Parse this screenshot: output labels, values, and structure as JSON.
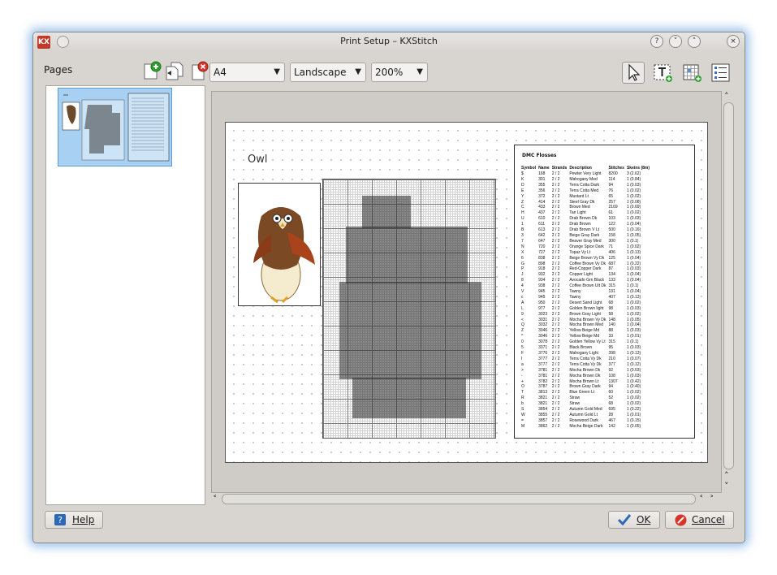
{
  "window": {
    "title": "Print Setup – KXStitch",
    "app_icon_text": "KX",
    "title_buttons": [
      "?",
      "˅",
      "˄",
      "×"
    ]
  },
  "pages_label": "Pages",
  "toolbar": {
    "paper_size": "A4",
    "orientation": "Landscape",
    "zoom": "200%",
    "icons": [
      "add-page-icon",
      "insert-page-icon",
      "delete-page-icon",
      "select-tool-icon",
      "text-tool-icon",
      "pattern-tool-icon",
      "key-tool-icon"
    ]
  },
  "preview": {
    "pattern_title": "Owl",
    "floss_title": "DMC Flosses",
    "floss_headers": [
      "Symbol",
      "Name",
      "Strands",
      "Description",
      "Stitches",
      "Skeins (8m)"
    ],
    "floss_rows": [
      [
        "$",
        "168",
        "2 / 2",
        "Pewter Very Light",
        "8200",
        "3 (2.62)"
      ],
      [
        "K",
        "301",
        "2 / 2",
        "Mahogany Med",
        "114",
        "1 (0.84)"
      ],
      [
        "D",
        "355",
        "2 / 2",
        "Terra Cotta Dark",
        "94",
        "1 (0.03)"
      ],
      [
        "E",
        "356",
        "2 / 2",
        "Terra Cotta Med",
        "76",
        "1 (0.02)"
      ],
      [
        "Y",
        "372",
        "2 / 2",
        "Mustard Lt",
        "65",
        "1 (0.02)"
      ],
      [
        "Z",
        "414",
        "2 / 2",
        "Steel Gray Dk",
        "257",
        "1 (0.08)"
      ],
      [
        "C",
        "433",
        "2 / 2",
        "Brown Med",
        "2169",
        "1 (0.69)"
      ],
      [
        "H",
        "437",
        "2 / 2",
        "Tan Light",
        "61",
        "1 (0.02)"
      ],
      [
        "U",
        "610",
        "2 / 2",
        "Drab Brown Dk",
        "103",
        "1 (0.03)"
      ],
      [
        "1",
        "611",
        "2 / 2",
        "Drab Brown",
        "122",
        "1 (0.04)"
      ],
      [
        "B",
        "613",
        "2 / 2",
        "Drab Brown V Lt",
        "500",
        "1 (0.16)"
      ],
      [
        "3",
        "642",
        "2 / 2",
        "Beige Gray Dark",
        "158",
        "1 (0.05)"
      ],
      [
        "7",
        "647",
        "2 / 2",
        "Beaver Gray Med",
        "300",
        "1 (0.1)"
      ],
      [
        "N",
        "720",
        "2 / 2",
        "Orange Spice Dark",
        "71",
        "1 (0.02)"
      ],
      [
        "X",
        "727",
        "2 / 2",
        "Topaz Vy Lt",
        "406",
        "1 (0.13)"
      ],
      [
        "6",
        "838",
        "2 / 2",
        "Beige Brown Vy Dk",
        "125",
        "1 (0.04)"
      ],
      [
        "G",
        "898",
        "2 / 2",
        "Coffee Brown Vy Dk",
        "687",
        "1 (0.22)"
      ],
      [
        "P",
        "918",
        "2 / 2",
        "Red-Copper Dark",
        "87",
        "1 (0.03)"
      ],
      [
        "J",
        "932",
        "2 / 2",
        "Copper Light",
        "134",
        "1 (0.04)"
      ],
      [
        "8",
        "934",
        "2 / 2",
        "Avocado Grn Black",
        "133",
        "1 (0.04)"
      ],
      [
        "4",
        "938",
        "2 / 2",
        "Coffee Brown Ult Dk",
        "315",
        "1 (0.1)"
      ],
      [
        "V",
        "945",
        "2 / 2",
        "Tawny",
        "131",
        "1 (0.04)"
      ],
      [
        "c",
        "945",
        "2 / 2",
        "Tawny",
        "407",
        "1 (0.13)"
      ],
      [
        "A",
        "950",
        "2 / 2",
        "Desert Sand Light",
        "68",
        "1 (0.02)"
      ],
      [
        "L",
        "977",
        "2 / 2",
        "Golden Brown light",
        "98",
        "1 (0.03)"
      ],
      [
        "9",
        "3023",
        "2 / 2",
        "Brown Gray Light",
        "58",
        "1 (0.02)"
      ],
      [
        "<",
        "3031",
        "2 / 2",
        "Mocha Brown Vy Dk",
        "148",
        "1 (0.05)"
      ],
      [
        "Q",
        "3032",
        "2 / 2",
        "Mocha Brown Med",
        "140",
        "1 (0.04)"
      ],
      [
        "Z",
        "3046",
        "2 / 2",
        "Yellow Beige Md",
        "88",
        "1 (0.03)"
      ],
      [
        "^",
        "3046",
        "2 / 2",
        "Yellow Beige Md",
        "33",
        "1 (0.01)"
      ],
      [
        "0",
        "3078",
        "2 / 2",
        "Golden Yellow Vy Lt",
        "315",
        "1 (0.1)"
      ],
      [
        "5",
        "3371",
        "2 / 2",
        "Black Brown",
        "95",
        "1 (0.03)"
      ],
      [
        "F",
        "3776",
        "2 / 2",
        "Mahogany Light",
        "398",
        "1 (0.13)"
      ],
      [
        "I",
        "3777",
        "2 / 2",
        "Terra Cotta Vy Dk",
        "210",
        "1 (0.07)"
      ],
      [
        "a",
        "3777",
        "2 / 2",
        "Terra Cotta Vy Dk",
        "377",
        "1 (0.12)"
      ],
      [
        ">",
        "3781",
        "2 / 2",
        "Mocha Brown Dk",
        "92",
        "1 (0.03)"
      ],
      [
        "-",
        "3781",
        "2 / 2",
        "Mocha Brown Dk",
        "108",
        "1 (0.03)"
      ],
      [
        "+",
        "3782",
        "2 / 2",
        "Mocha Brown Lt",
        "1307",
        "1 (0.42)"
      ],
      [
        "O",
        "3787",
        "2 / 2",
        "Brown Gray Dark",
        "94",
        "1 (0.40)"
      ],
      [
        "T",
        "3813",
        "2 / 2",
        "Blue Green Lt",
        "60",
        "1 (0.02)"
      ],
      [
        "R",
        "3821",
        "2 / 2",
        "Straw",
        "52",
        "1 (0.02)"
      ],
      [
        "b",
        "3821",
        "2 / 2",
        "Straw",
        "68",
        "1 (0.02)"
      ],
      [
        "S",
        "3854",
        "2 / 2",
        "Autumn Gold Med",
        "695",
        "1 (0.22)"
      ],
      [
        "W",
        "3855",
        "2 / 2",
        "Autumn Gold Lt",
        "28",
        "1 (0.01)"
      ],
      [
        "=",
        "3857",
        "2 / 2",
        "Rosewood Dark",
        "467",
        "1 (0.15)"
      ],
      [
        "M",
        "3862",
        "2 / 2",
        "Mocha Beige Dark",
        "142",
        "1 (0.05)"
      ]
    ]
  },
  "buttons": {
    "help": "Help",
    "ok": "OK",
    "cancel": "Cancel"
  },
  "colors": {
    "window_glow": "#468cd7",
    "selection": "#a8d0f2",
    "cancel_icon": "#d8352a",
    "ok_icon": "#2a6ab8"
  }
}
